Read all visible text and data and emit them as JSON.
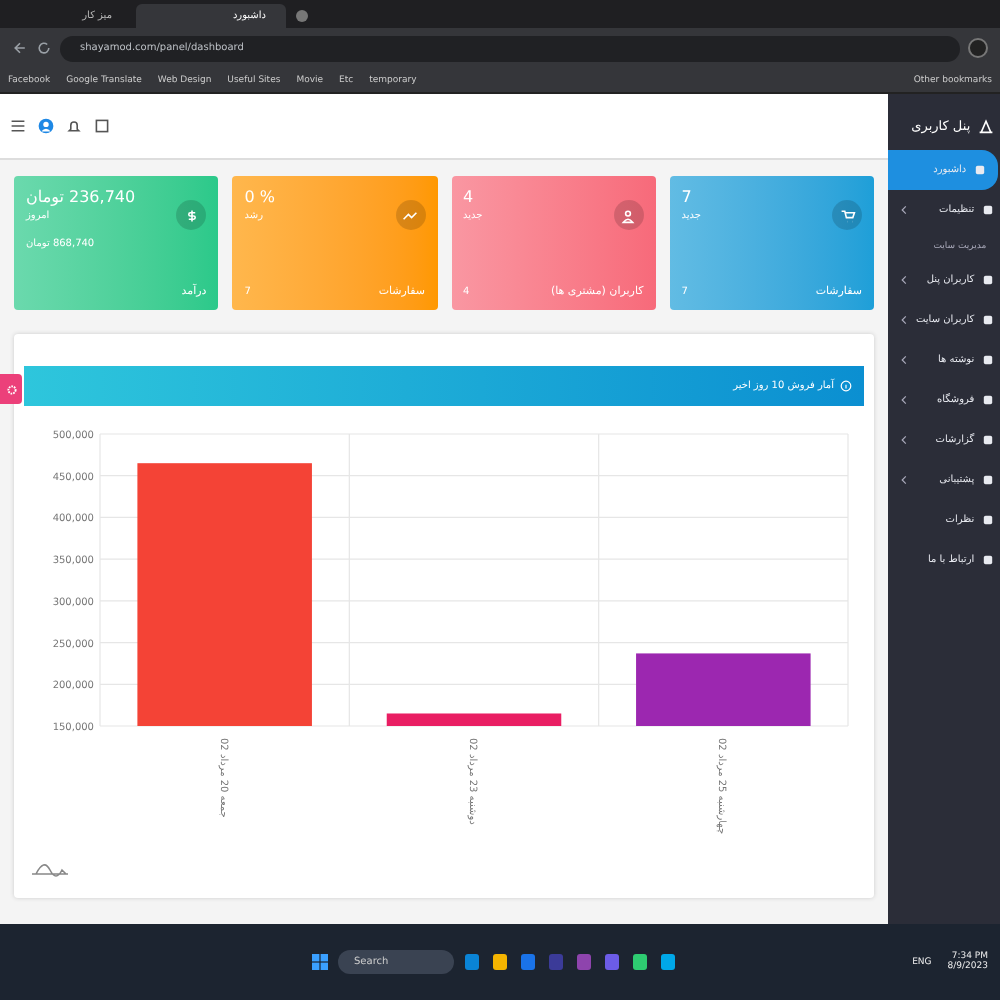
{
  "browser": {
    "tabs": [
      {
        "label": "داشبورد",
        "selected": true
      },
      {
        "label": "میز کار",
        "selected": false
      }
    ],
    "url": "shayamod.com/panel/dashboard",
    "bookmarks": [
      "temporary",
      "Etc",
      "Movie",
      "Useful Sites",
      "Web Design",
      "Google Translate",
      "Facebook"
    ],
    "other_bookmarks": "Other bookmarks"
  },
  "cards": [
    {
      "title": "سفارشات",
      "value": "7",
      "sub": "جدید",
      "count": "7",
      "color": "#1e9fd8"
    },
    {
      "title": "کاربران (مشتری ها)",
      "value": "4",
      "sub": "جدید",
      "count": "4",
      "color": "#f76a7a"
    },
    {
      "title": "سفارشات",
      "value": "% 0",
      "sub": "رشد",
      "count": "7",
      "color": "#ff9800"
    },
    {
      "title": "درآمد",
      "value": "236,740 تومان",
      "sub": "امروز",
      "total": "868,740 تومان",
      "color": "#2bc98a"
    }
  ],
  "chart": {
    "title": "آمار فروش 10 روز اخیر",
    "chart_data": {
      "type": "bar",
      "categories": [
        "جمعه 20 مرداد 02",
        "دوشنبه 23 مرداد 02",
        "چهارشنبه 25 مرداد 02"
      ],
      "series": [
        {
          "color": "#f44336",
          "values": [
            465000,
            null,
            null
          ]
        },
        {
          "color": "#e91e63",
          "values": [
            null,
            165000,
            null
          ]
        },
        {
          "color": "#9c27b0",
          "values": [
            null,
            null,
            237000
          ]
        }
      ],
      "ylim": [
        150000,
        500000
      ],
      "grid": true,
      "yticks": [
        {
          "value": 150000,
          "label": "150,000"
        },
        {
          "value": 200000,
          "label": "200,000"
        },
        {
          "value": 250000,
          "label": "250,000"
        },
        {
          "value": 300000,
          "label": "300,000"
        },
        {
          "value": 350000,
          "label": "350,000"
        },
        {
          "value": 400000,
          "label": "400,000"
        },
        {
          "value": 450000,
          "label": "450,000"
        },
        {
          "value": 500000,
          "label": "500,000"
        }
      ]
    }
  },
  "sidebar": {
    "title": "پنل کاربری",
    "items": [
      {
        "label": "داشبورد",
        "selected": true,
        "expandable": false
      },
      {
        "label": "تنظیمات",
        "selected": false,
        "expandable": true
      },
      {
        "kind": "header",
        "label": "مدیریت سایت"
      },
      {
        "label": "کاربران پنل",
        "selected": false,
        "expandable": true
      },
      {
        "label": "کاربران سایت",
        "selected": false,
        "expandable": true
      },
      {
        "label": "نوشته ها",
        "selected": false,
        "expandable": true
      },
      {
        "label": "فروشگاه",
        "selected": false,
        "expandable": true
      },
      {
        "label": "گزارشات",
        "selected": false,
        "expandable": true
      },
      {
        "label": "پشتیبانی",
        "selected": false,
        "expandable": true
      },
      {
        "label": "نظرات",
        "selected": false,
        "expandable": false
      },
      {
        "label": "ارتباط با ما",
        "selected": false,
        "expandable": false
      }
    ]
  },
  "taskbar": {
    "search": "Search",
    "language": "ENG",
    "time": "7:34 PM",
    "date": "8/9/2023"
  }
}
